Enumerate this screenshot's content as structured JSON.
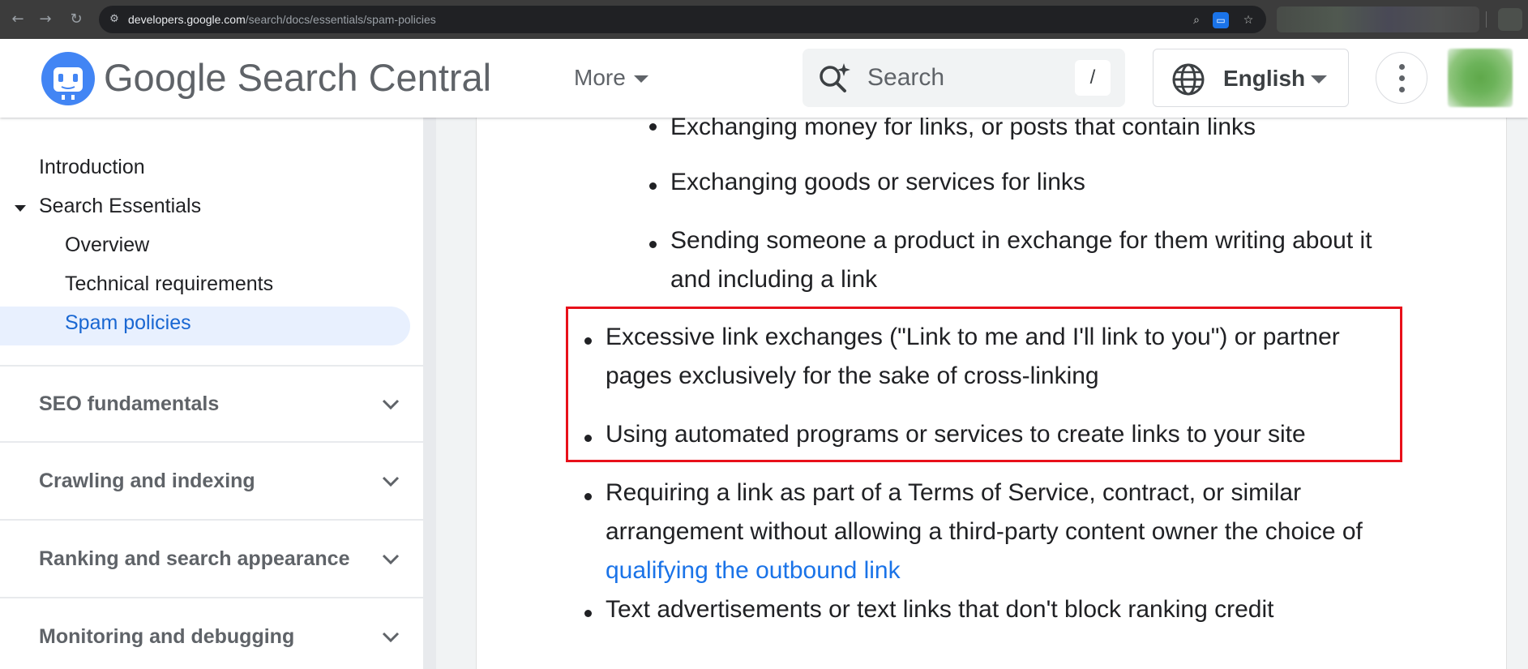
{
  "browser": {
    "url_host": "developers.google.com",
    "url_path": "/search/docs/essentials/spam-policies"
  },
  "header": {
    "brand_google": "Google",
    "brand_product": "Search Central",
    "more_label": "More",
    "search_placeholder": "Search",
    "search_shortcut": "/",
    "language_label": "English"
  },
  "sidebar": {
    "items": [
      {
        "label": "Introduction"
      },
      {
        "label": "Search Essentials"
      },
      {
        "label": "Overview"
      },
      {
        "label": "Technical requirements"
      },
      {
        "label": "Spam policies",
        "active": true
      }
    ],
    "sections": [
      {
        "label": "SEO fundamentals"
      },
      {
        "label": "Crawling and indexing"
      },
      {
        "label": "Ranking and search appearance"
      },
      {
        "label": "Monitoring and debugging"
      }
    ]
  },
  "article": {
    "nested_items": [
      {
        "text": "Exchanging money for links, or posts that contain links"
      },
      {
        "text": "Exchanging goods or services for links"
      },
      {
        "line1": "Sending someone a product in exchange for them writing about it",
        "line2": "and including a link"
      }
    ],
    "items": [
      {
        "line1": "Excessive link exchanges (\"Link to me and I'll link to you\") or partner",
        "line2": "pages exclusively for the sake of cross-linking"
      },
      {
        "text": "Using automated programs or services to create links to your site"
      },
      {
        "line1": "Requiring a link as part of a Terms of Service, contract, or similar",
        "line2": "arrangement without allowing a third-party content owner the choice of",
        "link": "qualifying the outbound link"
      },
      {
        "text": "Text advertisements or text links that don't block ranking credit"
      }
    ]
  },
  "colors": {
    "link": "#1a73e8",
    "highlight_border": "#e8101a",
    "active_nav_bg": "#e8f0fe",
    "active_nav_text": "#1967d2"
  }
}
